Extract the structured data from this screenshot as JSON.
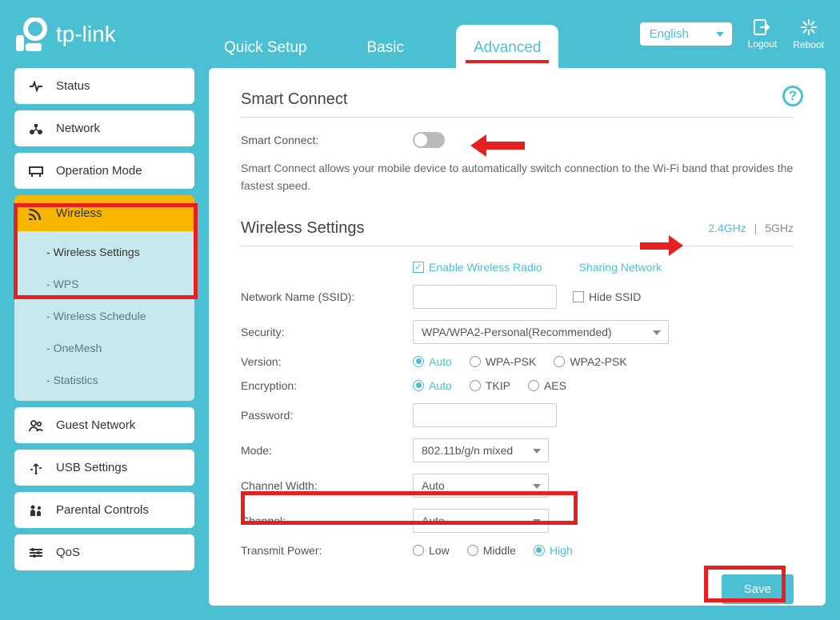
{
  "brand": "tp-link",
  "tabs": {
    "quick": "Quick Setup",
    "basic": "Basic",
    "advanced": "Advanced"
  },
  "language": "English",
  "headerButtons": {
    "logout": "Logout",
    "reboot": "Reboot"
  },
  "sidebar": {
    "status": "Status",
    "network": "Network",
    "operation": "Operation Mode",
    "wireless": "Wireless",
    "guest": "Guest Network",
    "usb": "USB Settings",
    "parental": "Parental Controls",
    "qos": "QoS",
    "sub": {
      "wireless_settings": "Wireless Settings",
      "wps": "WPS",
      "schedule": "Wireless Schedule",
      "onemesh": "OneMesh",
      "statistics": "Statistics"
    }
  },
  "smart": {
    "title": "Smart Connect",
    "label": "Smart Connect:",
    "desc": "Smart Connect allows your mobile device to automatically switch connection to the Wi-Fi band that provides the fastest speed."
  },
  "ws": {
    "title": "Wireless Settings",
    "band24": "2.4GHz",
    "band5": "5GHz",
    "enable_radio": "Enable Wireless Radio",
    "sharing": "Sharing Network",
    "ssid_label": "Network Name (SSID):",
    "ssid_value": "",
    "hide_ssid": "Hide SSID",
    "security_label": "Security:",
    "security_value": "WPA/WPA2-Personal(Recommended)",
    "version_label": "Version:",
    "version_opts": {
      "auto": "Auto",
      "wpa": "WPA-PSK",
      "wpa2": "WPA2-PSK"
    },
    "encryption_label": "Encryption:",
    "encryption_opts": {
      "auto": "Auto",
      "tkip": "TKIP",
      "aes": "AES"
    },
    "password_label": "Password:",
    "password_value": "",
    "mode_label": "Mode:",
    "mode_value": "802.11b/g/n mixed",
    "cw_label": "Channel Width:",
    "cw_value": "Auto",
    "channel_label": "Channel:",
    "channel_value": "Auto",
    "tx_label": "Transmit Power:",
    "tx_opts": {
      "low": "Low",
      "middle": "Middle",
      "high": "High"
    },
    "save": "Save"
  }
}
